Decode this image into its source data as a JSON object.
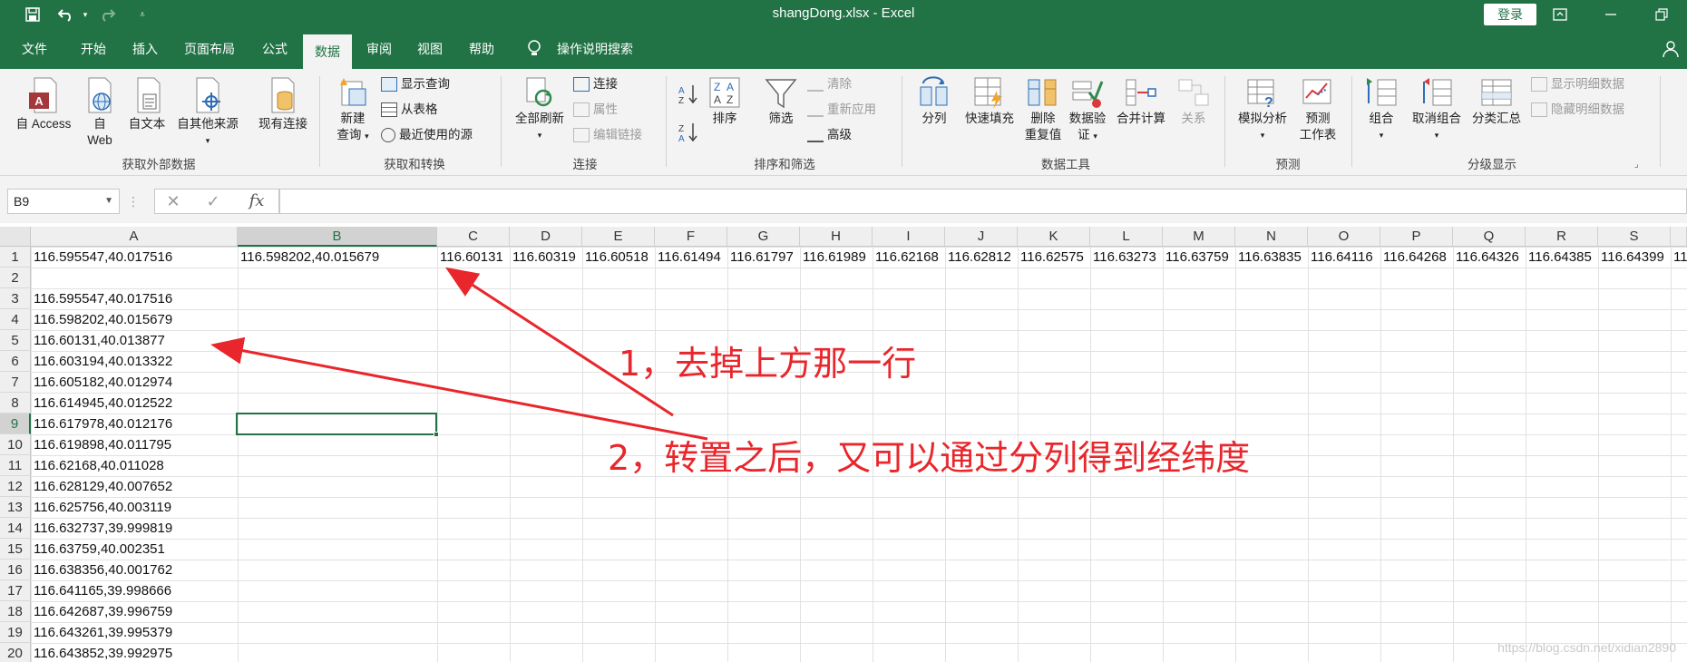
{
  "window": {
    "title": "shangDong.xlsx  -  Excel",
    "login": "登录"
  },
  "tabs": [
    "文件",
    "开始",
    "插入",
    "页面布局",
    "公式",
    "数据",
    "审阅",
    "视图",
    "帮助"
  ],
  "active_tab": "数据",
  "tell_me": "操作说明搜索",
  "ribbon": {
    "get_external": {
      "access": "自 Access",
      "web_1": "自",
      "web_2": "Web",
      "text": "自文本",
      "other": "自其他来源",
      "existing": "现有连接",
      "label": "获取外部数据"
    },
    "get_transform": {
      "new_query_1": "新建",
      "new_query_2": "查询",
      "show_query": "显示查询",
      "from_table": "从表格",
      "recent": "最近使用的源",
      "label": "获取和转换"
    },
    "connections": {
      "refresh_all": "全部刷新",
      "connections": "连接",
      "properties": "属性",
      "edit_links": "编辑链接",
      "label": "连接"
    },
    "sort_filter": {
      "sort": "排序",
      "filter": "筛选",
      "clear": "清除",
      "reapply": "重新应用",
      "advanced": "高级",
      "label": "排序和筛选"
    },
    "data_tools": {
      "split": "分列",
      "flash_fill": "快速填充",
      "remove_dup_1": "删除",
      "remove_dup_2": "重复值",
      "validation_1": "数据验",
      "validation_2": "证",
      "consolidate": "合并计算",
      "relationships": "关系",
      "label": "数据工具"
    },
    "forecast": {
      "what_if": "模拟分析",
      "sheet_1": "预测",
      "sheet_2": "工作表",
      "label": "预测"
    },
    "outline": {
      "group": "组合",
      "ungroup": "取消组合",
      "subtotal": "分类汇总",
      "show_detail": "显示明细数据",
      "hide_detail": "隐藏明细数据",
      "label": "分级显示"
    }
  },
  "formula_bar": {
    "name_box": "B9",
    "cancel": "✕",
    "enter": "✓",
    "fx": "fx",
    "value": ""
  },
  "columns": [
    "A",
    "B",
    "C",
    "D",
    "E",
    "F",
    "G",
    "H",
    "I",
    "J",
    "K",
    "L",
    "M",
    "N",
    "O",
    "P",
    "Q",
    "R",
    "S"
  ],
  "rows": [
    "1",
    "2",
    "3",
    "4",
    "5",
    "6",
    "7",
    "8",
    "9",
    "10",
    "11",
    "12",
    "13",
    "14",
    "15",
    "16",
    "17",
    "18",
    "19",
    "20"
  ],
  "row1": [
    "116.595547,40.017516",
    "116.598202,40.015679",
    "116.60131",
    "116.60319",
    "116.60518",
    "116.61494",
    "116.61797",
    "116.61989",
    "116.62168",
    "116.62812",
    "116.62575",
    "116.63273",
    "116.63759",
    "116.63835",
    "116.64116",
    "116.64268",
    "116.64326",
    "116.64385",
    "116.64399"
  ],
  "colA": [
    "116.595547,40.017516",
    "116.598202,40.015679",
    "116.60131,40.013877",
    "116.603194,40.013322",
    "116.605182,40.012974",
    "116.614945,40.012522",
    "116.617978,40.012176",
    "116.619898,40.011795",
    "116.62168,40.011028",
    "116.628129,40.007652",
    "116.625756,40.003119",
    "116.632737,39.999819",
    "116.63759,40.002351",
    "116.638356,40.001762",
    "116.641165,39.998666",
    "116.642687,39.996759",
    "116.643261,39.995379",
    "116.643852,39.992975"
  ],
  "annotations": {
    "note1": "1，去掉上方那一行",
    "note2": "2，转置之后，又可以通过分列得到经纬度"
  },
  "colors": {
    "brand": "#217346",
    "annotation": "#e8262b"
  },
  "watermark": "https://blog.csdn.net/xidian2890"
}
